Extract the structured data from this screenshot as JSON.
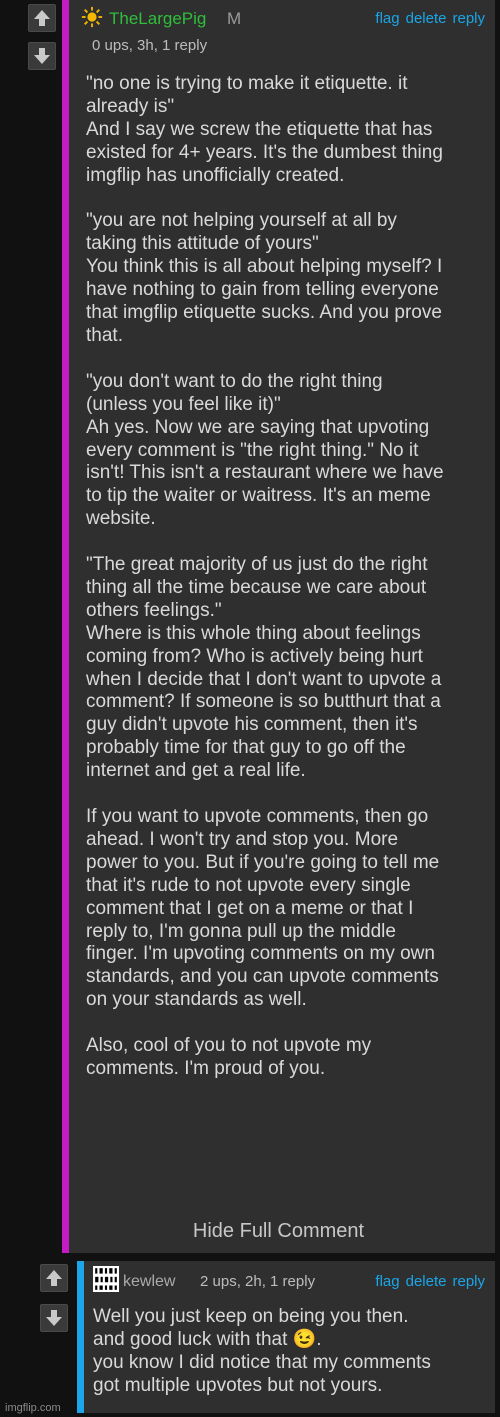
{
  "comment1": {
    "username": "TheLargePig",
    "badge": "M",
    "meta": "0 ups, 3h, 1 reply",
    "actions": {
      "flag": "flag",
      "delete": "delete",
      "reply": "reply"
    },
    "body": "\"no one is trying to make it etiquette. it\nalready is\"\nAnd I say we screw the etiquette that has\nexisted for 4+ years. It's the dumbest thing\nimgflip has unofficially created.\n\n\"you are not helping yourself at all by\ntaking this attitude of yours\"\nYou think this is all about helping myself? I\nhave nothing to gain from telling everyone\nthat imgflip etiquette sucks. And you prove\nthat.\n\n\"you don't want to do the right thing\n(unless you feel like it)\"\nAh yes. Now we are saying that upvoting\nevery comment is \"the right thing.\" No it\nisn't! This isn't a restaurant where we have\nto tip the waiter or waitress. It's an meme\nwebsite.\n\n\"The great majority of us just do the right\nthing all the time because we care about\nothers feelings.\"\nWhere is this whole thing about feelings\ncoming from? Who is actively being hurt\nwhen I decide that I don't want to upvote a\ncomment? If someone is so butthurt that a\nguy didn't upvote his comment, then it's\nprobably time for that guy to go off the\ninternet and get a real life.\n\nIf you want to upvote comments, then go\nahead. I won't try and stop you. More\npower to you. But if you're going to tell me\nthat it's rude to not upvote every single\ncomment that I get on a meme or that I\nreply to, I'm gonna pull up the middle\nfinger. I'm upvoting comments on my own\nstandards, and you can upvote comments\non your standards as well.\n\nAlso, cool of you to not upvote my\ncomments. I'm proud of you.",
    "hide_label": "Hide Full Comment",
    "accent_color": "#c51bc5",
    "username_color": "#2fbf3a"
  },
  "comment2": {
    "username": "kewlew",
    "meta": "2 ups, 2h, 1 reply",
    "actions": {
      "flag": "flag",
      "delete": "delete",
      "reply": "reply"
    },
    "body": "Well you just keep on being you then.\nand good luck with that 😉.\nyou know I did notice that my comments\ngot multiple upvotes but not yours.",
    "accent_color": "#1aa6e8",
    "username_color": "#aaaaaa"
  },
  "icons": [
    "upvote-icon",
    "downvote-icon",
    "sun-avatar-icon",
    "binary-avatar-icon"
  ],
  "watermark": "imgflip.com"
}
